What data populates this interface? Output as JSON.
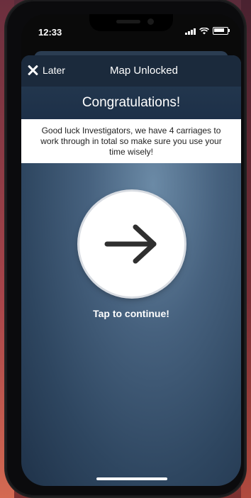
{
  "status_bar": {
    "time": "12:33"
  },
  "nav": {
    "close_label": "Later",
    "title": "Map Unlocked"
  },
  "banner": {
    "heading": "Congratulations!"
  },
  "message": {
    "text": "Good luck Investigators, we have 4 carriages to work through in total so make sure you use your time wisely!"
  },
  "continue": {
    "icon": "arrow-right-icon",
    "label": "Tap to continue!"
  },
  "colors": {
    "navbar": "#1b2a3c",
    "background_blue": "#46617e",
    "message_bg": "#ffffff"
  }
}
